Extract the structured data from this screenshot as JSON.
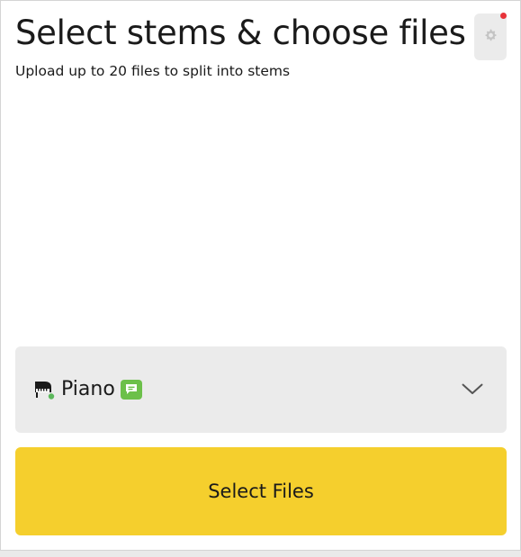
{
  "header": {
    "title": "Select stems & choose files",
    "subtitle": "Upload up to 20 files to split into stems"
  },
  "settings": {
    "icon": "gear-icon",
    "has_notification": true,
    "notification_color": "#e8333a"
  },
  "instrument": {
    "icon": "piano-icon",
    "label": "Piano",
    "badge_icon": "chat-badge-icon",
    "badge_color": "#6cc04a",
    "dropdown_icon": "chevron-down-icon"
  },
  "actions": {
    "select_files_label": "Select Files",
    "select_files_color": "#f5cf2d"
  }
}
